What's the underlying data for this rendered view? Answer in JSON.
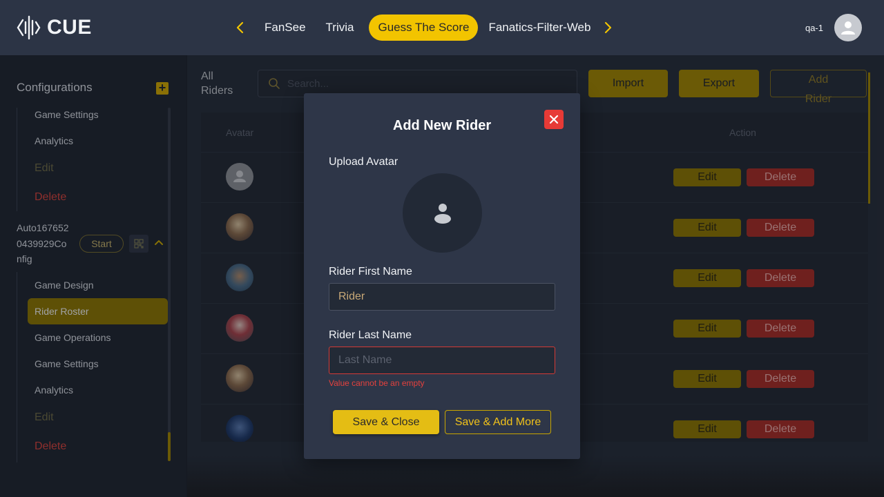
{
  "header": {
    "logo_text": "CUE",
    "nav": [
      "FanSee",
      "Trivia",
      "Guess The Score",
      "Fanatics-Filter-Web"
    ],
    "active_nav": "Guess The Score",
    "username": "qa-1"
  },
  "sidebar": {
    "title": "Configurations",
    "group1": [
      "Game Settings",
      "Analytics",
      "Edit",
      "Delete"
    ],
    "config_name": "Auto1676520439929Config",
    "config_name_lines": [
      "Auto167652",
      "0439929Co",
      "nfig"
    ],
    "start_label": "Start",
    "group2": [
      "Game Design",
      "Rider Roster",
      "Game Operations",
      "Game Settings",
      "Analytics",
      "Edit",
      "Delete"
    ],
    "active_item": "Rider Roster"
  },
  "main": {
    "heading_lines": [
      "All",
      "Riders"
    ],
    "search_placeholder": "Search...",
    "import_label": "Import",
    "export_label": "Export",
    "add_label_lines": [
      "Add",
      "Rider"
    ],
    "columns": [
      "Avatar",
      "Action"
    ],
    "rows": [
      {
        "edit": "Edit",
        "delete": "Delete"
      },
      {
        "edit": "Edit",
        "delete": "Delete"
      },
      {
        "edit": "Edit",
        "delete": "Delete"
      },
      {
        "edit": "Edit",
        "delete": "Delete"
      },
      {
        "edit": "Edit",
        "delete": "Delete"
      },
      {
        "edit": "Edit",
        "delete": "Delete"
      }
    ]
  },
  "modal": {
    "title": "Add New Rider",
    "upload_label": "Upload Avatar",
    "first_name_label": "Rider First Name",
    "first_name_value": "Rider",
    "last_name_label": "Rider Last Name",
    "last_name_placeholder": "Last Name",
    "error": "Value cannot be an empty",
    "save_close": "Save & Close",
    "save_more": "Save & Add More"
  },
  "colors": {
    "accent": "#f2c400",
    "danger": "#e73a36",
    "topbar": "#2c3445",
    "modal": "#2e3648"
  }
}
